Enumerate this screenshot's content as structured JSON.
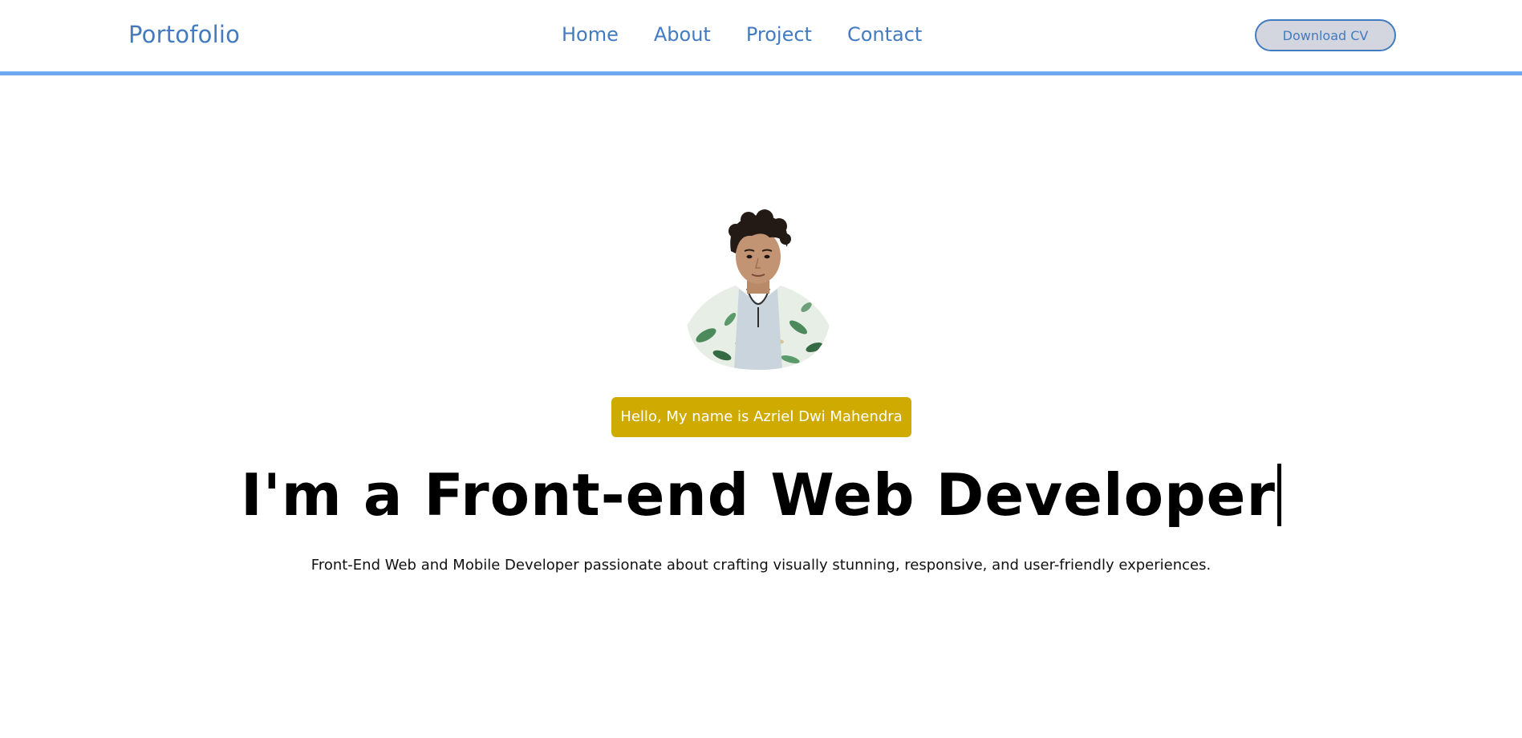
{
  "header": {
    "brand": "Portofolio",
    "nav": [
      {
        "label": "Home"
      },
      {
        "label": "About"
      },
      {
        "label": "Project"
      },
      {
        "label": "Contact"
      }
    ],
    "cv_button": "Download CV"
  },
  "hero": {
    "avatar_icon": "profile-photo",
    "greeting": "Hello, My name is Azriel Dwi Mahendra",
    "headline": "I'm a Front-end Web Developer",
    "tagline": "Front-End Web and Mobile Developer passionate about crafting visually stunning, responsive, and user-friendly experiences."
  },
  "colors": {
    "accent": "#437bc0",
    "nav_border": "#6ea7f2",
    "badge": "#cfab02",
    "button_bg": "#d3d6df"
  }
}
